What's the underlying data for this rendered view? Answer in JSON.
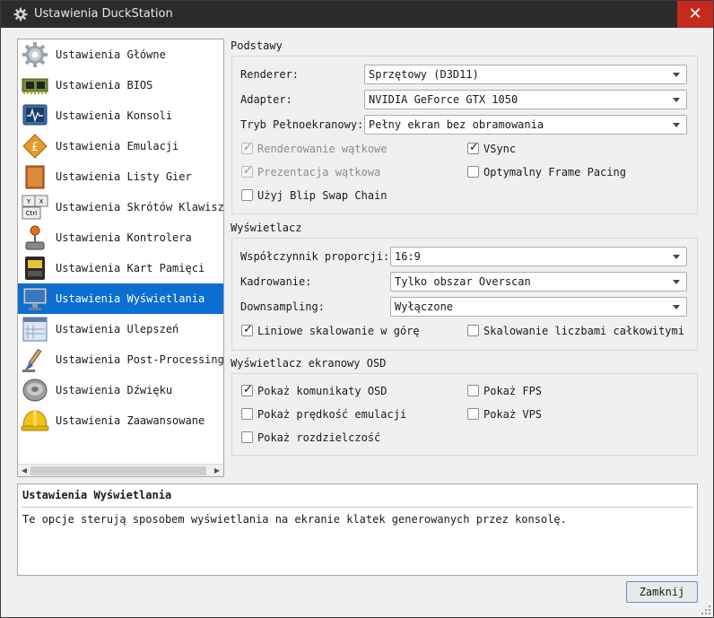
{
  "window": {
    "title": "Ustawienia DuckStation",
    "close_glyph": "✕"
  },
  "sidebar": {
    "items": [
      {
        "label": "Ustawienia Główne",
        "icon": "general-settings-gear-icon"
      },
      {
        "label": "Ustawienia BIOS",
        "icon": "bios-chip-icon"
      },
      {
        "label": "Ustawienia Konsoli",
        "icon": "console-monitor-icon"
      },
      {
        "label": "Ustawienia Emulacji",
        "icon": "emulation-diamond-icon"
      },
      {
        "label": "Ustawienia Listy Gier",
        "icon": "game-list-folder-icon"
      },
      {
        "label": "Ustawienia Skrótów Klawiszowych",
        "icon": "hotkeys-keyboard-icon"
      },
      {
        "label": "Ustawienia Kontrolera",
        "icon": "controller-joystick-icon"
      },
      {
        "label": "Ustawienia Kart Pamięci",
        "icon": "memory-card-icon"
      },
      {
        "label": "Ustawienia Wyświetlania",
        "icon": "display-monitor-icon",
        "selected": true
      },
      {
        "label": "Ustawienia Ulepszeń",
        "icon": "enhancements-window-icon"
      },
      {
        "label": "Ustawienia Post-Processingu",
        "icon": "post-processing-brush-icon"
      },
      {
        "label": "Ustawienia Dźwięku",
        "icon": "audio-speaker-icon"
      },
      {
        "label": "Ustawienia Zaawansowane",
        "icon": "advanced-helmet-icon"
      }
    ],
    "scroll_left": "◀",
    "scroll_right": "▶"
  },
  "basics": {
    "title": "Podstawy",
    "renderer_label": "Renderer:",
    "renderer_value": "Sprzętowy (D3D11)",
    "adapter_label": "Adapter:",
    "adapter_value": "NVIDIA GeForce GTX 1050",
    "fullscreen_label": "Tryb Pełnoekranowy:",
    "fullscreen_value": "Pełny ekran bez obramowania",
    "threaded_rendering": {
      "label": "Renderowanie wątkowe",
      "checked": true,
      "disabled": true
    },
    "vsync": {
      "label": "VSync",
      "checked": true,
      "disabled": false
    },
    "threaded_presentation": {
      "label": "Prezentacja wątkowa",
      "checked": true,
      "disabled": true
    },
    "optimal_frame_pacing": {
      "label": "Optymalny Frame Pacing",
      "checked": false,
      "disabled": false
    },
    "blip_swap_chain": {
      "label": "Użyj Blip Swap Chain",
      "checked": false,
      "disabled": false
    }
  },
  "display": {
    "title": "Wyświetlacz",
    "aspect_label": "Współczynnik proporcji:",
    "aspect_value": "16:9",
    "crop_label": "Kadrowanie:",
    "crop_value": "Tylko obszar Overscan",
    "downsampling_label": "Downsampling:",
    "downsampling_value": "Wyłączone",
    "linear_upscaling": {
      "label": "Liniowe skalowanie w górę",
      "checked": true
    },
    "integer_scaling": {
      "label": "Skalowanie liczbami całkowitymi",
      "checked": false
    }
  },
  "osd": {
    "title": "Wyświetlacz ekranowy OSD",
    "show_messages": {
      "label": "Pokaż komunikaty OSD",
      "checked": true
    },
    "show_fps": {
      "label": "Pokaż FPS",
      "checked": false
    },
    "show_speed": {
      "label": "Pokaż prędkość emulacji",
      "checked": false
    },
    "show_vps": {
      "label": "Pokaż VPS",
      "checked": false
    },
    "show_resolution": {
      "label": "Pokaż rozdzielczość",
      "checked": false
    }
  },
  "description": {
    "title": "Ustawienia Wyświetlania",
    "text": "Te opcje sterują sposobem wyświetlania na ekranie klatek generowanych przez konsolę."
  },
  "footer": {
    "close_label": "Zamknij"
  },
  "check_glyph": "✓",
  "colors": {
    "selection": "#0a6fd1",
    "titlebar": "#2b2b2b",
    "close_hover": "#c42b1c"
  }
}
